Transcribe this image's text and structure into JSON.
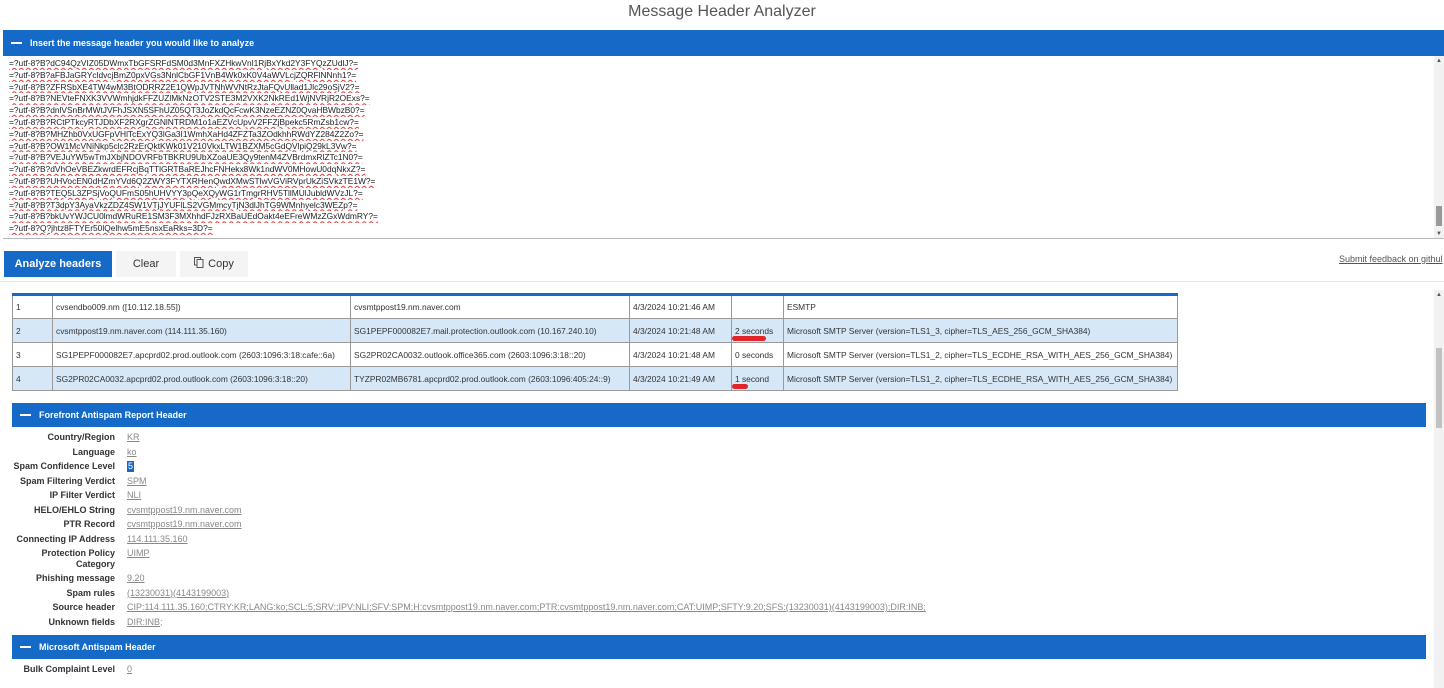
{
  "app_title": "Message Header Analyzer",
  "input_section": {
    "title": "Insert the message header you would like to analyze",
    "lines": [
      "=?utf-8?B?dC94QzVIZ05DWmxTbGFSRFdSM0d3MnFXZHkwVnl1RjBxYkd2Y3FYQzZUdlJ?=",
      "=?utf-8?B?aFBJaGRYcldvcjBmZ0pxVGs3NnlCbGF1VnB4Wk0xK0V4aWVLcjZQRFlNNnh1?=",
      "=?utf-8?B?ZFRSbXE4TW4wM3BtODRRZ2E1QWpJVTNhWVNtRzJtaFQvUllad1Jlc29oSjV2?=",
      "=?utf-8?B?NEVteFNXK3VVWmhjdkFFZUZlMkNzOTV2STE3M2VXK2NkREd1WjNVRjR2OExs?=",
      "=?utf-8?B?dnlVSnBrMWtJVFhJSXN5SFhUZ05QT3JoZkdQcFcwK3NzeEZNZ0QvaHBWbzB0?=",
      "=?utf-8?B?RCtPTkcyRTJDbXF2RXgrZGNlNTRDM1o1aEZVcUpvV2FFZjBpekc5RmZsb1cw?=",
      "=?utf-8?B?MHZhb0VxUGFpVHlTcExYQ3lGa3I1WmhXaHd4ZFZTa3ZOdkhhRWdYZ284Z2Zo?=",
      "=?utf-8?B?OW1McVNiNkp5clc2RzErQktKWk01V210VkxLTW1BZXM5cGdQVlpiQ29kL3Vw?=",
      "=?utf-8?B?VEJuYW5wTmJXbjNDOVRFbTBKRU9UbXZoaUE3Qy9tenM4ZVBrdmxRlZTc1N0?=",
      "=?utf-8?B?dVhOeVBEZkwrdEFRcjBqTTlGRTBaREJhcFNHekx8Wk1ndWV0MHowU0dqNkxZ?=",
      "=?utf-8?B?UHVocEN0dHZmYVd6Q2ZWY3FYTXRHenQwdXMwSTlwVGViRVprUkZiSVkzTE1W?=",
      "=?utf-8?B?TEQ5L3ZPSjVoQUFmS05hUHVYY3pQeXQyWG1rTmgrRHV5TllMUlJubldWVzJL?=",
      "=?utf-8?B?T3dpY3AyaVkzZDZ4SW1VTjJYUFlLS2VGMmcyTjN3dlJhTG9WMnhyelc3WEZp?=",
      "=?utf-8?B?bkUvYWJCU0lmdWRuRE1SM3F3MXhhdFJzRXBaUEdOakt4eEFreWMzZGxWdmRY?=",
      "=?utf-8?Q?jhtz8FTYEr50lQelhw5mE5nsxEaRks=3D?="
    ]
  },
  "buttons": {
    "analyze": "Analyze headers",
    "clear": "Clear",
    "copy": "Copy",
    "copy_icon": "copy-icon"
  },
  "feedback_link": "Submit feedback on githul",
  "hops": [
    {
      "num": "1",
      "from": "cvsendbo009.nm ([10.112.18.55])",
      "by": "cvsmtppost19.nm.naver.com",
      "time": "4/3/2024 10:21:46 AM",
      "delay": "",
      "with": "ESMTP"
    },
    {
      "num": "2",
      "from": "cvsmtppost19.nm.naver.com (114.111.35.160)",
      "by": "SG1PEPF000082E7.mail.protection.outlook.com (10.167.240.10)",
      "time": "4/3/2024 10:21:48 AM",
      "delay": "2 seconds",
      "with": "Microsoft SMTP Server (version=TLS1_3, cipher=TLS_AES_256_GCM_SHA384)"
    },
    {
      "num": "3",
      "from": "SG1PEPF000082E7.apcprd02.prod.outlook.com (2603:1096:3:18:cafe::6a)",
      "by": "SG2PR02CA0032.outlook.office365.com (2603:1096:3:18::20)",
      "time": "4/3/2024 10:21:48 AM",
      "delay": "0 seconds",
      "with": "Microsoft SMTP Server (version=TLS1_2, cipher=TLS_ECDHE_RSA_WITH_AES_256_GCM_SHA384)"
    },
    {
      "num": "4",
      "from": "SG2PR02CA0032.apcprd02.prod.outlook.com (2603:1096:3:18::20)",
      "by": "TYZPR02MB6781.apcprd02.prod.outlook.com (2603:1096:405:24::9)",
      "time": "4/3/2024 10:21:49 AM",
      "delay": "1 second",
      "with": "Microsoft SMTP Server (version=TLS1_2, cipher=TLS_ECDHE_RSA_WITH_AES_256_GCM_SHA384)"
    }
  ],
  "forefront": {
    "title": "Forefront Antispam Report Header",
    "fields": [
      {
        "key": "Country/Region",
        "value": "KR"
      },
      {
        "key": "Language",
        "value": "ko"
      },
      {
        "key": "Spam Confidence Level",
        "value": "5"
      },
      {
        "key": "Spam Filtering Verdict",
        "value": "SPM"
      },
      {
        "key": "IP Filter Verdict",
        "value": "NLI"
      },
      {
        "key": "HELO/EHLO String",
        "value": "cvsmtppost19.nm.naver.com"
      },
      {
        "key": "PTR Record",
        "value": "cvsmtppost19.nm.naver.com"
      },
      {
        "key": "Connecting IP Address",
        "value": "114.111.35.160"
      },
      {
        "key": "Protection Policy Category",
        "value": "UIMP"
      },
      {
        "key": "Phishing message",
        "value": "9.20"
      },
      {
        "key": "Spam rules",
        "value": "(13230031)(4143199003)"
      },
      {
        "key": "Source header",
        "value": "CIP:114.111.35.160;CTRY:KR;LANG:ko;SCL:5;SRV:;IPV:NLI;SFV:SPM;H:cvsmtppost19.nm.naver.com;PTR:cvsmtppost19.nm.naver.com;CAT:UIMP;SFTY:9.20;SFS:(13230031)(4143199003);DIR:INB;"
      },
      {
        "key": "Unknown fields",
        "value": "DIR:INB;"
      }
    ]
  },
  "microsoft": {
    "title": "Microsoft Antispam Header",
    "fields": [
      {
        "key": "Bulk Complaint Level",
        "value": "0"
      }
    ]
  }
}
